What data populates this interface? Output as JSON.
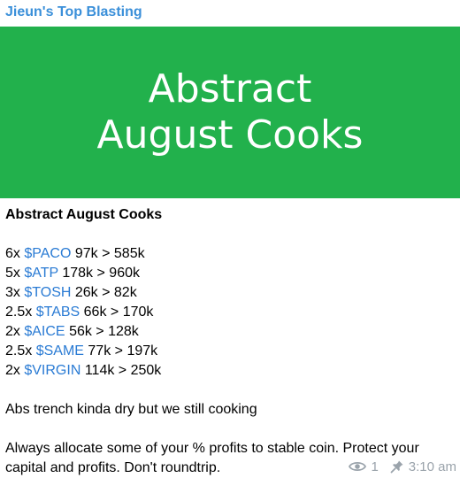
{
  "channel": {
    "name": "Jieun's Top Blasting"
  },
  "banner": {
    "line1": "Abstract",
    "line2": "August Cooks",
    "color": "#22b14c"
  },
  "post": {
    "title": "Abstract August Cooks",
    "calls": [
      {
        "mult": "6x",
        "ticker": "$PACO",
        "range": "97k > 585k"
      },
      {
        "mult": "5x",
        "ticker": "$ATP",
        "range": "178k > 960k"
      },
      {
        "mult": "3x",
        "ticker": "$TOSH",
        "range": "26k > 82k"
      },
      {
        "mult": "2.5x",
        "ticker": "$TABS",
        "range": "66k > 170k"
      },
      {
        "mult": "2x",
        "ticker": "$AICE",
        "range": "56k > 128k"
      },
      {
        "mult": "2.5x",
        "ticker": "$SAME",
        "range": "77k > 197k"
      },
      {
        "mult": "2x",
        "ticker": "$VIRGIN",
        "range": "114k > 250k"
      }
    ],
    "note": "Abs trench kinda dry but we still cooking",
    "advice_line1": "Always allocate some of your % profits to stable coin. Protect your",
    "advice_line2": "capital and profits. Don't roundtrip."
  },
  "meta": {
    "views": "1",
    "time": "3:10 am",
    "views_icon": "eye-icon",
    "pin_icon": "pin-icon"
  }
}
